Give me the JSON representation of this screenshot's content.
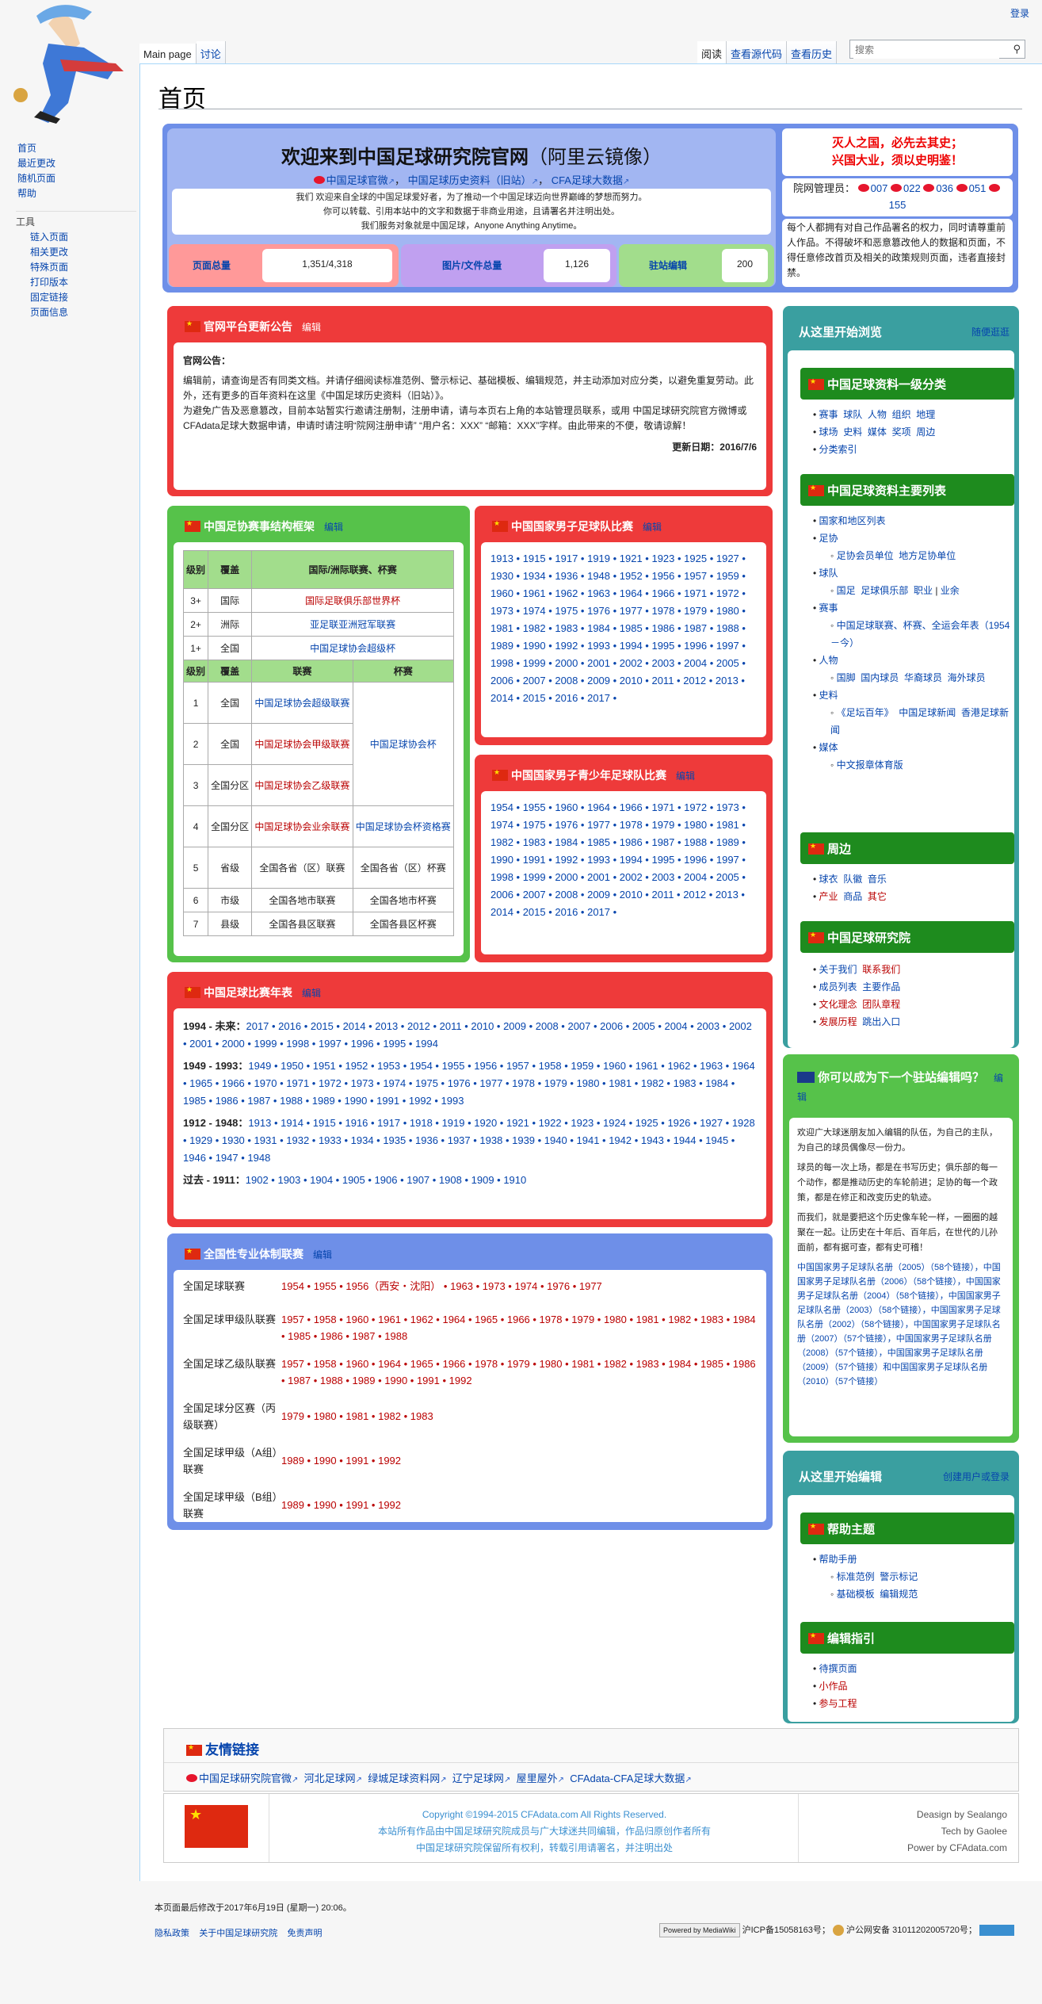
{
  "user_links": {
    "login": "登录"
  },
  "tabs_left": [
    "Main page",
    "讨论"
  ],
  "tabs_right": [
    "阅读",
    "查看源代码",
    "查看历史"
  ],
  "search": {
    "placeholder": "搜索",
    "icon": "search-icon"
  },
  "sidebar": {
    "nav": [
      "首页",
      "最近更改",
      "随机页面",
      "帮助"
    ],
    "tools_heading": "工具",
    "tools": [
      "链入页面",
      "相关更改",
      "特殊页面",
      "打印版本",
      "固定链接",
      "页面信息"
    ]
  },
  "page_title": "首页",
  "welcome": {
    "title": "欢迎来到中国足球研究院官网",
    "title_suffix": "（阿里云镜像）",
    "links": [
      "中国足球官微",
      "中国足球历史资料（旧站）",
      "CFA足球大数据"
    ],
    "line1": "我们 欢迎来自全球的中国足球爱好者，为了推动一个中国足球迈向世界巅峰的梦想而努力。",
    "line2": "你可以转载、引用本站中的文字和数据于非商业用途，且请署名并注明出处。",
    "line3": "我们服务对象就是中国足球，Anyone Anything Anytime。",
    "stats": [
      {
        "label": "页面总量",
        "value": "1,351/4,318",
        "color": "#ff9999"
      },
      {
        "label": "图片/文件总量",
        "value": "1,126",
        "color": "#c0a0f0"
      },
      {
        "label": "驻站编辑",
        "value": "200",
        "color": "#a2dd8c"
      }
    ]
  },
  "slogan": {
    "line1": "灭人之国，必先去其史；",
    "line2": "兴国大业，须以史明鉴！"
  },
  "admins": {
    "label": "院网管理员：",
    "ids": [
      "007",
      "022",
      "036",
      "051",
      "155"
    ]
  },
  "notice_right": "每个人都拥有对自己作品署名的权力，同时请尊重前人作品。不得破坏和恶意篡改他人的数据和页面，不得任意修改首页及相关的政策规则页面，违者直接封禁。",
  "announce": {
    "title": "官网平台更新公告",
    "edit": "编辑",
    "heading": "官网公告：",
    "p1": "编辑前，请查询是否有同类文档。并请仔细阅读标准范例、警示标记、基础模板、编辑规范，并主动添加对应分类，以避免重复劳动。此外，还有更多的百年资料在这里《中国足球历史资料（旧站）》。",
    "p2": "为避免广告及恶意篡改，目前本站暂实行邀请注册制，注册申请，请与本页右上角的本站管理员联系，或用 中国足球研究院官方微博或 CFAdata足球大数据申请，申请时请注明“院网注册申请” “用户名：XXX” “邮箱：XXX”字样。由此带来的不便，敬请谅解！",
    "date": "更新日期：2016/7/6"
  },
  "structure": {
    "title": "中国足协赛事结构框架",
    "edit": "编辑",
    "head": [
      "级别",
      "覆盖",
      "国际/洲际联赛、杯赛"
    ],
    "intl": [
      [
        "3+",
        "国际",
        "国际足联俱乐部世界杯"
      ],
      [
        "2+",
        "洲际",
        "亚足联亚洲冠军联赛"
      ],
      [
        "1+",
        "全国",
        "中国足球协会超级杯"
      ]
    ],
    "head2": [
      "级别",
      "覆盖",
      "联赛",
      "杯赛"
    ],
    "rows": [
      [
        "1",
        "全国",
        "中国足球协会超级联赛"
      ],
      [
        "2",
        "全国",
        "中国足球协会甲级联赛"
      ],
      [
        "3",
        "全国分区",
        "中国足球协会乙级联赛"
      ],
      [
        "4",
        "全国分区",
        "中国足球协会业余联赛",
        "中国足球协会杯资格赛"
      ],
      [
        "5",
        "省级",
        "全国各省（区）联赛",
        "全国各省（区）杯赛"
      ],
      [
        "6",
        "市级",
        "全国各地市联赛",
        "全国各地市杯赛"
      ],
      [
        "7",
        "县级",
        "全国各县区联赛",
        "全国各县区杯赛"
      ]
    ],
    "fa_cup": "中国足球协会杯"
  },
  "men_national": {
    "title": "中国国家男子足球队比赛",
    "edit": "编辑",
    "years": "1913 • 1915 • 1917 • 1919 • 1921 • 1923 • 1925 • 1927 • 1930 • 1934 • 1936 • 1948 • 1952 • 1956 • 1957 • 1959 • 1960 • 1961 • 1962 • 1963 • 1964 • 1966 • 1971 • 1972 • 1973 • 1974 • 1975 • 1976 • 1977 • 1978 • 1979 • 1980 • 1981 • 1982 • 1983 • 1984 • 1985 • 1986 • 1987 • 1988 • 1989 • 1990 • 1992 • 1993 • 1994 • 1995 • 1996 • 1997 • 1998 • 1999 • 2000 • 2001 • 2002 • 2003 • 2004 • 2005 • 2006 • 2007 • 2008 • 2009 • 2010 • 2011 • 2012 • 2013 • 2014 • 2015 • 2016 • 2017 •"
  },
  "youth_national": {
    "title": "中国国家男子青少年足球队比赛",
    "edit": "编辑",
    "years": "1954 • 1955 • 1960 • 1964 • 1966 • 1971 • 1972 • 1973 • 1974 • 1975 • 1976 • 1977 • 1978 • 1979 • 1980 • 1981 • 1982 • 1983 • 1984 • 1985 • 1986 • 1987 • 1988 • 1989 • 1990 • 1991 • 1992 • 1993 • 1994 • 1995 • 1996 • 1997 • 1998 • 1999 • 2000 • 2001 • 2002 • 2003 • 2004 • 2005 • 2006 • 2007 • 2008 • 2009 • 2010 • 2011 • 2012 • 2013 • 2014 • 2015 • 2016 • 2017 •"
  },
  "yearbook": {
    "title": "中国足球比赛年表",
    "edit": "编辑",
    "rows": [
      {
        "label": "1994 - 未来：",
        "years": "2017 • 2016 • 2015 • 2014 • 2013 • 2012 • 2011 • 2010 • 2009 • 2008 • 2007 • 2006 • 2005 • 2004 • 2003 • 2002 • 2001 • 2000 • 1999 • 1998 • 1997 • 1996 • 1995 • 1994"
      },
      {
        "label": "1949 - 1993：",
        "years": "1949 • 1950 • 1951 • 1952 • 1953 • 1954 • 1955 • 1956 • 1957 • 1958 • 1959 • 1960 • 1961 • 1962 • 1963 • 1964 • 1965 • 1966 • 1970 • 1971 • 1972 • 1973 • 1974 • 1975 • 1976 • 1977 • 1978 • 1979 • 1980 • 1981 • 1982 • 1983 • 1984 • 1985 • 1986 • 1987 • 1988 • 1989 • 1990 • 1991 • 1992 • 1993"
      },
      {
        "label": "1912 - 1948：",
        "years": "1913 • 1914 • 1915 • 1916 • 1917 • 1918 • 1919 • 1920 • 1921 • 1922 • 1923 • 1924 • 1925 • 1926 • 1927 • 1928 • 1929 • 1930 • 1931 • 1932 • 1933 • 1934 • 1935 • 1936 • 1937 • 1938 • 1939 • 1940 • 1941 • 1942 • 1943 • 1944 • 1945 • 1946 • 1947 • 1948"
      },
      {
        "label": "过去 - 1911：",
        "years": "1902 • 1903 • 1904 • 1905 • 1906 • 1907 • 1908 • 1909 • 1910"
      }
    ]
  },
  "pro_league": {
    "title": "全国性专业体制联赛",
    "edit": "编辑",
    "rows": [
      {
        "label": "全国足球联赛",
        "years": "1954 • 1955 • 1956（西安・沈阳） • 1963 • 1973 • 1974 • 1976 • 1977"
      },
      {
        "label": "全国足球甲级队联赛",
        "years": "1957 • 1958 • 1960 • 1961 • 1962 • 1964 • 1965 • 1966 • 1978 • 1979 • 1980 • 1981 • 1982 • 1983 • 1984 • 1985 • 1986 • 1987 • 1988"
      },
      {
        "label": "全国足球乙级队联赛",
        "years": "1957 • 1958 • 1960 • 1964 • 1965 • 1966 • 1978 • 1979 • 1980 • 1981 • 1982 • 1983 • 1984 • 1985 • 1986 • 1987 • 1988 • 1989 • 1990 • 1991 • 1992"
      },
      {
        "label": "全国足球分区赛（丙级联赛）",
        "years": "1979 • 1980 • 1981 • 1982 • 1983"
      },
      {
        "label": "全国足球甲级（A组）联赛",
        "years": "1989 • 1990 • 1991 • 1992"
      },
      {
        "label": "全国足球甲级（B组）联赛",
        "years": "1989 • 1990 • 1991 • 1992"
      }
    ]
  },
  "browse": {
    "title": "从这里开始浏览",
    "action": "随便逛逛",
    "cat1": {
      "title": "中国足球资料一级分类",
      "items": [
        "赛事",
        "球队",
        "人物",
        "组织",
        "地理",
        "球场",
        "史料",
        "媒体",
        "奖项",
        "周边",
        "分类索引"
      ]
    },
    "cat2": {
      "title": "中国足球资料主要列表",
      "items": [
        "国家和地区列表",
        "足协",
        "足协会员单位",
        "地方足协单位",
        "球队",
        "国足",
        "足球俱乐部",
        "职业",
        "业余",
        "赛事",
        "中国足球联赛、杯赛、全运会年表（1954－今）",
        "人物",
        "国脚",
        "国内球员",
        "华裔球员",
        "海外球员",
        "史料",
        "《足坛百年》",
        "中国足球新闻",
        "香港足球新闻",
        "媒体",
        "中文报章体育版"
      ]
    },
    "cat3": {
      "title": "周边",
      "items": [
        "球衣",
        "队徽",
        "音乐",
        "产业",
        "商品",
        "其它"
      ]
    },
    "cat4": {
      "title": "中国足球研究院",
      "items": [
        "关于我们",
        "联系我们",
        "成员列表",
        "主要作品",
        "文化理念",
        "团队章程",
        "发展历程",
        "跳出入口"
      ]
    }
  },
  "resident": {
    "title": "你可以成为下一个驻站编辑吗？",
    "edit": "编辑",
    "p1": "欢迎广大球迷朋友加入编辑的队伍，为自己的主队，为自己的球员偶像尽一份力。",
    "p2": "球员的每一次上场，都是在书写历史；俱乐部的每一个动作，都是推动历史的车轮前进；足协的每一个政策，都是在修正和改变历史的轨迹。",
    "p3": "而我们，就是要把这个历史像车轮一样，一圈圈的越聚在一起。让历史在十年后、百年后，在世代的儿孙面前，都有据可查，都有史可稽！",
    "links": "中国国家男子足球队名册（2005）（58个链接），中国国家男子足球队名册（2006）（58个链接），中国国家男子足球队名册（2004）（58个链接），中国国家男子足球队名册（2003）（58个链接），中国国家男子足球队名册（2002）（58个链接），中国国家男子足球队名册（2007）（57个链接），中国国家男子足球队名册（2008）（57个链接），中国国家男子足球队名册（2009）（57个链接）和中国国家男子足球队名册（2010）（57个链接）"
  },
  "editing": {
    "title": "从这里开始编辑",
    "action": "创建用户或登录",
    "help": {
      "title": "帮助主题",
      "items": [
        "帮助手册",
        "标准范例",
        "警示标记",
        "基础模板",
        "编辑规范"
      ]
    },
    "guide": {
      "title": "编辑指引",
      "items": [
        "待撰页面",
        "小作品",
        "参与工程"
      ]
    }
  },
  "friend_links": {
    "title": "友情链接",
    "items": [
      "中国足球研究院官微",
      "河北足球网",
      "绿城足球资料网",
      "辽宁足球网",
      "屋里屋外",
      "CFAdata-CFA足球大数据"
    ]
  },
  "footer_box": {
    "copyright": "Copyright ©1994-2015 CFAdata.com All Rights Reserved.",
    "line2": "本站所有作品由中国足球研究院成员与广大球迷共同编辑，作品归原创作者所有",
    "line3": "中国足球研究院保留所有权利，转载引用请署名，并注明出处",
    "credits": [
      "Deasign by Sealango",
      "Tech by Gaolee",
      "Power by CFAdata.com"
    ]
  },
  "footer": {
    "lastmod": "本页面最后修改于2017年6月19日 (星期一) 20:06。",
    "links": [
      "隐私政策",
      "关于中国足球研究院",
      "免责声明"
    ],
    "icp": "沪ICP备15058163号",
    "police": "沪公网安备 31011202005720号",
    "mediawiki": "Powered by MediaWiki"
  },
  "colors": {
    "blue_box": "#6e8fe8",
    "red_box": "#ee3a3a",
    "green_box": "#56c24a",
    "flag": "#de2910"
  }
}
